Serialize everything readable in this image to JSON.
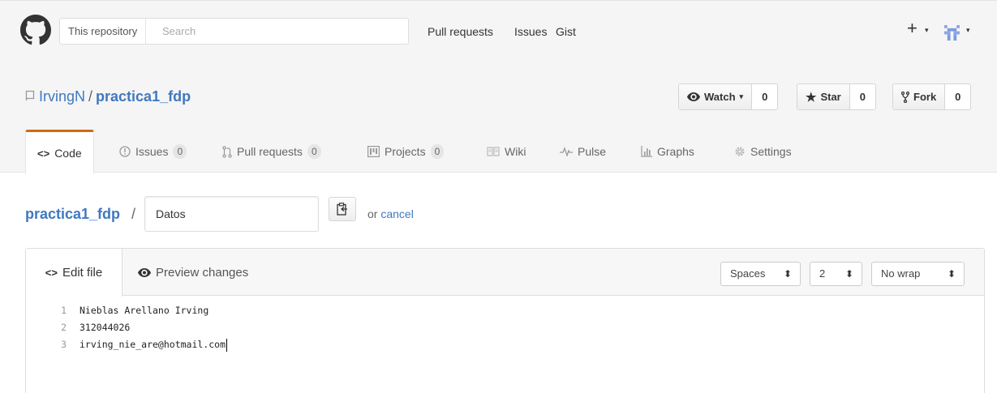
{
  "header": {
    "scope_label": "This repository",
    "search_placeholder": "Search",
    "nav": [
      "Pull requests",
      "Issues",
      "Gist"
    ],
    "new_label": "+",
    "icons": [
      "github-logo-icon",
      "plus-icon",
      "avatar-icon"
    ]
  },
  "repo": {
    "owner": "IrvingN",
    "separator": "/",
    "name": "practica1_fdp",
    "watch": {
      "label": "Watch",
      "count": "0"
    },
    "star": {
      "label": "Star",
      "count": "0"
    },
    "fork": {
      "label": "Fork",
      "count": "0"
    }
  },
  "tabs": [
    {
      "label": "Code",
      "counter": "",
      "icon": "code-icon",
      "selected": true
    },
    {
      "label": "Issues",
      "counter": "0",
      "icon": "issue-opened-icon"
    },
    {
      "label": "Pull requests",
      "counter": "0",
      "icon": "git-pull-request-icon"
    },
    {
      "label": "Projects",
      "counter": "0",
      "icon": "project-icon"
    },
    {
      "label": "Wiki",
      "counter": "",
      "icon": "book-icon"
    },
    {
      "label": "Pulse",
      "counter": "",
      "icon": "pulse-icon"
    },
    {
      "label": "Graphs",
      "counter": "",
      "icon": "graph-icon"
    },
    {
      "label": "Settings",
      "counter": "",
      "icon": "gear-icon"
    }
  ],
  "breadcrumb": {
    "root": "practica1_fdp",
    "separator": "/",
    "filename": "Datos",
    "or_text": "or",
    "cancel": "cancel"
  },
  "editor": {
    "edit_tab": "Edit file",
    "preview_tab": "Preview changes",
    "indent_mode": "Spaces",
    "indent_size": "2",
    "wrap_mode": "No wrap",
    "lines": [
      {
        "num": "1",
        "text": "Nieblas Arellano Irving"
      },
      {
        "num": "2",
        "text": "312044026"
      },
      {
        "num": "3",
        "text": "irving_nie_are@hotmail.com"
      }
    ]
  },
  "colors": {
    "link": "#4078c0",
    "selected_tab_accent": "#d26911",
    "header_bg": "#f5f5f5"
  }
}
